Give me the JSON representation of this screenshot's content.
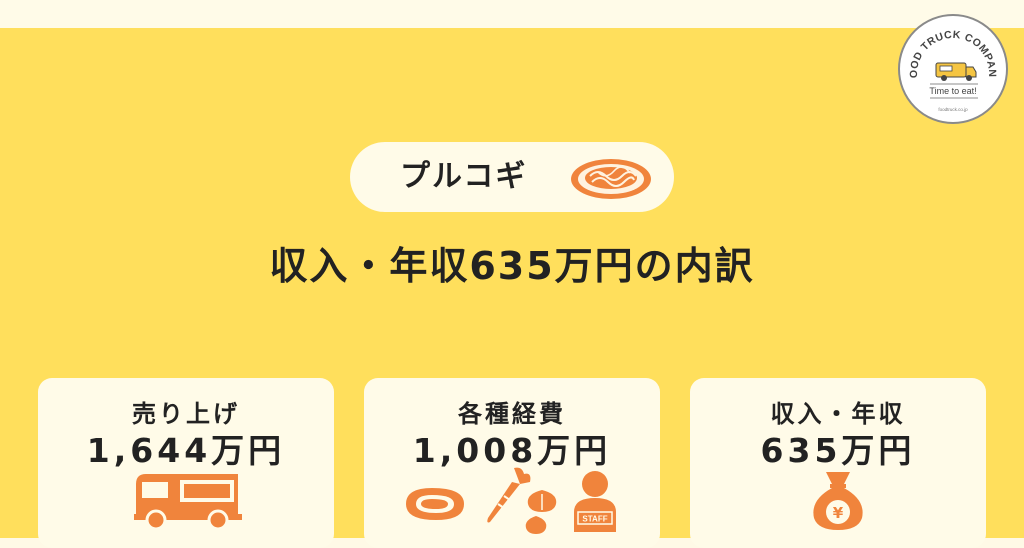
{
  "brand": {
    "arc_text": "FOOD TRUCK COMPANY",
    "tagline": "Time to eat!",
    "url": "foodtruck.co.jp"
  },
  "dish": {
    "name": "プルコギ",
    "icon": "pasta-plate-icon"
  },
  "headline": "収入・年収635万円の内訳",
  "cards": [
    {
      "label": "売り上げ",
      "value": "1,644万円",
      "icon": "food-truck-icon"
    },
    {
      "label": "各種経費",
      "value": "1,008万円",
      "icons": [
        "meat-icon",
        "carrot-icon",
        "garlic-icon",
        "staff-icon"
      ],
      "staff_text": "STAFF"
    },
    {
      "label": "収入・年収",
      "value": "635万円",
      "icon": "money-bag-icon",
      "currency": "¥"
    }
  ],
  "colors": {
    "background_panel": "#ffdf5c",
    "card": "#fffbe8",
    "accent_orange": "#f0843c",
    "text": "#222222"
  }
}
